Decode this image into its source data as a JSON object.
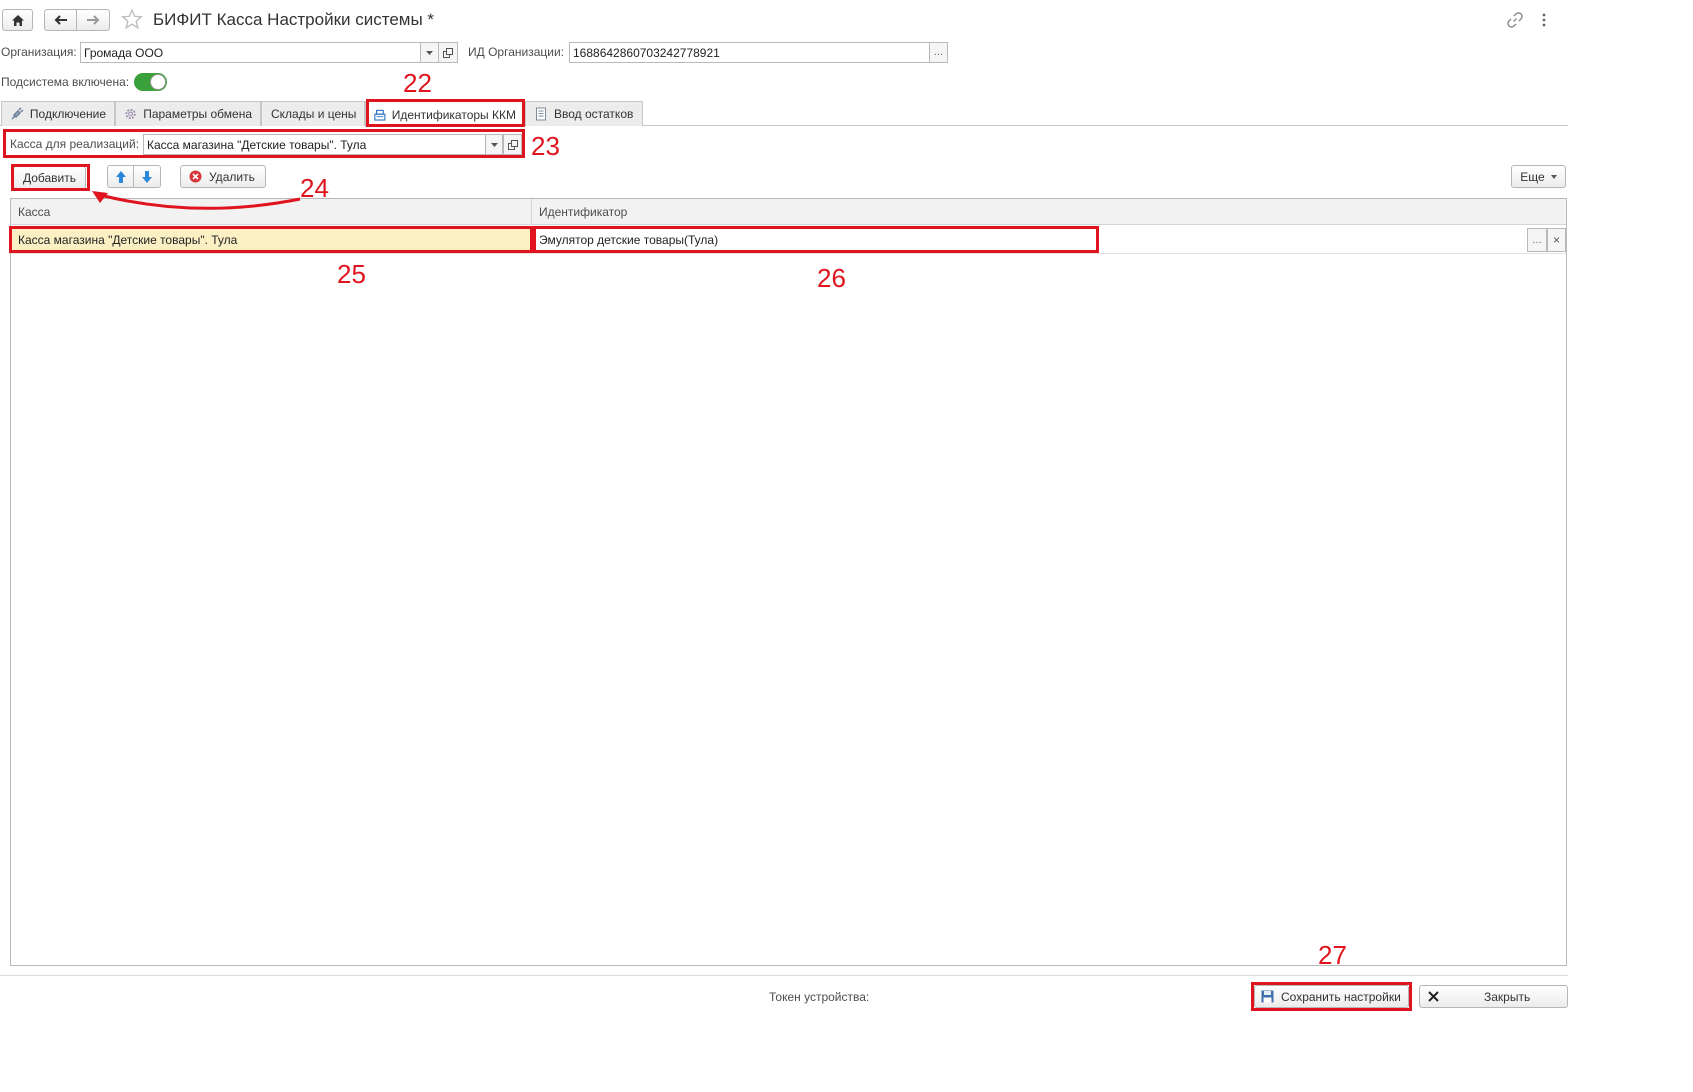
{
  "window": {
    "title": "БИФИТ Касса Настройки системы *"
  },
  "header": {
    "org_label": "Организация:",
    "org_value": "Громада ООО",
    "org_id_label": "ИД Организации:",
    "org_id_value": "1688642860703242778921",
    "subsystem_label": "Подсистема включена:",
    "subsystem_enabled": true
  },
  "tabs": [
    {
      "label": "Подключение",
      "icon": "plug-icon"
    },
    {
      "label": "Параметры обмена",
      "icon": "gear-icon"
    },
    {
      "label": "Склады и цены",
      "icon": ""
    },
    {
      "label": "Идентификаторы ККМ",
      "icon": "cash-register-icon",
      "active": true
    },
    {
      "label": "Ввод остатков",
      "icon": "document-icon"
    }
  ],
  "kassa_filter": {
    "label": "Касса для реализаций:",
    "value": "Касса магазина \"Детские товары\". Тула"
  },
  "toolbar": {
    "add_label": "Добавить",
    "delete_label": "Удалить",
    "more_label": "Еще"
  },
  "table": {
    "columns": [
      "Касса",
      "Идентификатор"
    ],
    "rows": [
      {
        "kassa": "Касса магазина \"Детские товары\". Тула",
        "identifier": "Эмулятор детские товары(Тула)"
      }
    ]
  },
  "footer": {
    "token_label": "Токен устройства:",
    "save_label": "Сохранить настройки",
    "close_label": "Закрыть"
  },
  "annotations": {
    "n22": "22",
    "n23": "23",
    "n24": "24",
    "n25": "25",
    "n26": "26",
    "n27": "27"
  },
  "colors": {
    "annotation_red": "#e0141e",
    "toggle_green": "#3aa03a",
    "selected_cell": "#fbf0c4"
  }
}
